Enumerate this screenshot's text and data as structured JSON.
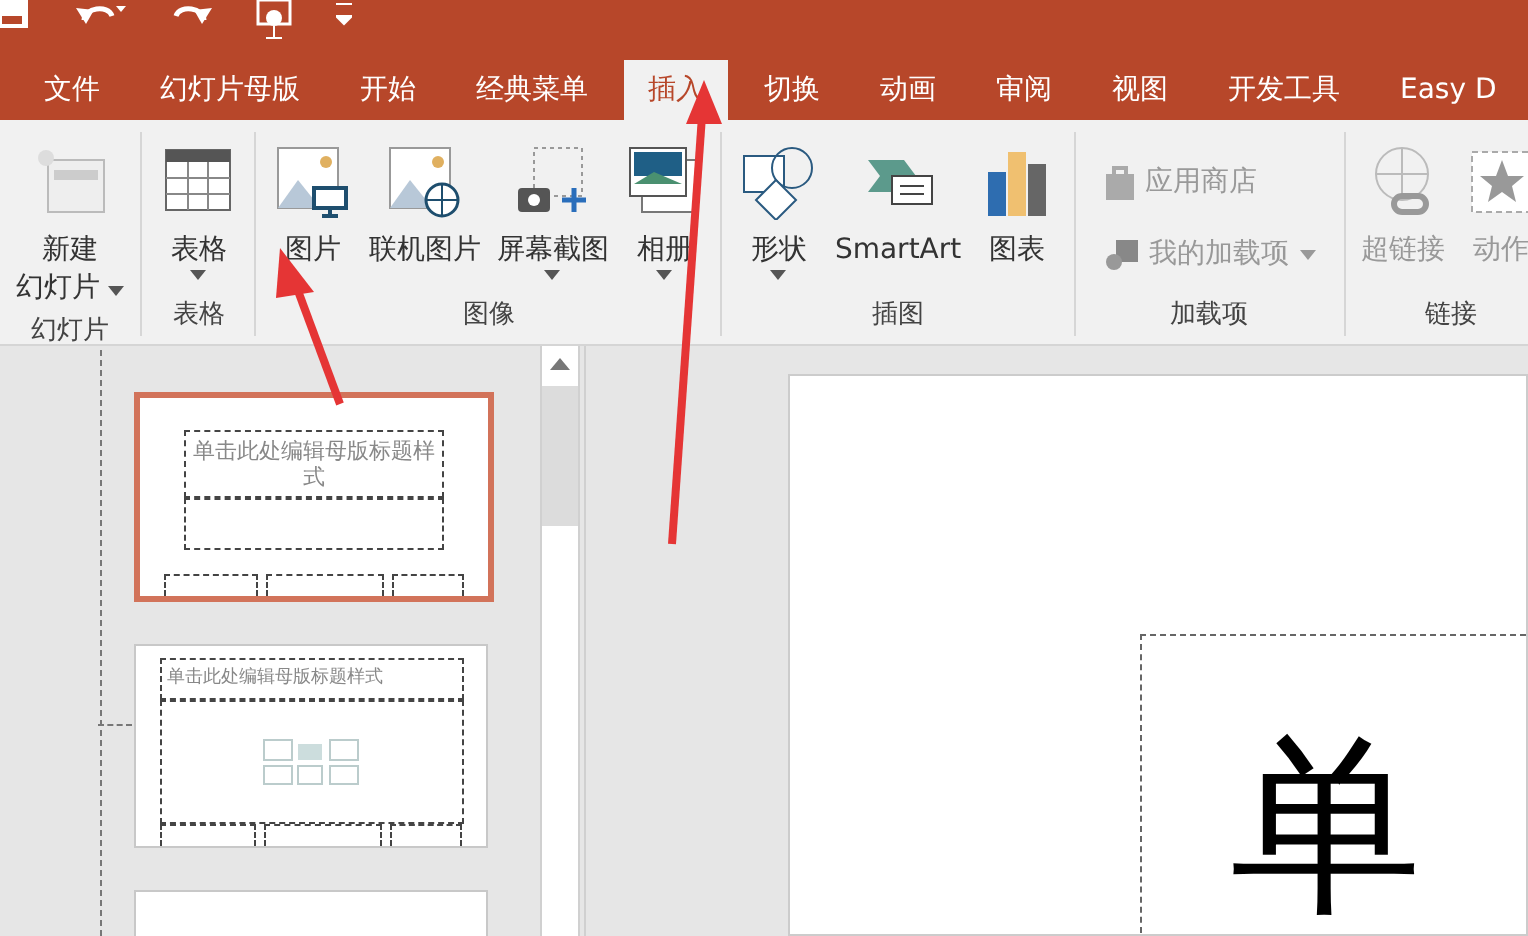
{
  "tabs": [
    {
      "label": "文件",
      "selected": false
    },
    {
      "label": "幻灯片母版",
      "selected": false
    },
    {
      "label": "开始",
      "selected": false
    },
    {
      "label": "经典菜单",
      "selected": false
    },
    {
      "label": "插入",
      "selected": true
    },
    {
      "label": "切换",
      "selected": false
    },
    {
      "label": "动画",
      "selected": false
    },
    {
      "label": "审阅",
      "selected": false
    },
    {
      "label": "视图",
      "selected": false
    },
    {
      "label": "开发工具",
      "selected": false
    },
    {
      "label": "Easy D",
      "selected": false
    }
  ],
  "ribbon_groups": [
    {
      "label": "幻灯片",
      "items": [
        {
          "kind": "large",
          "lines": [
            "新建",
            "幻灯片"
          ],
          "dropdown": true,
          "disabled": false
        }
      ]
    },
    {
      "label": "表格",
      "items": [
        {
          "kind": "large",
          "lines": [
            "表格"
          ],
          "dropdown": true,
          "disabled": false
        }
      ]
    },
    {
      "label": "图像",
      "items": [
        {
          "kind": "large",
          "lines": [
            "图片"
          ],
          "dropdown": false,
          "disabled": false
        },
        {
          "kind": "large",
          "lines": [
            "联机图片"
          ],
          "dropdown": false,
          "disabled": false
        },
        {
          "kind": "large",
          "lines": [
            "屏幕截图"
          ],
          "dropdown": true,
          "disabled": false
        },
        {
          "kind": "large",
          "lines": [
            "相册"
          ],
          "dropdown": true,
          "disabled": false
        }
      ]
    },
    {
      "label": "插图",
      "items": [
        {
          "kind": "large",
          "lines": [
            "形状"
          ],
          "dropdown": true,
          "disabled": false
        },
        {
          "kind": "large",
          "lines": [
            "SmartArt"
          ],
          "dropdown": false,
          "disabled": false
        },
        {
          "kind": "large",
          "lines": [
            "图表"
          ],
          "dropdown": false,
          "disabled": false
        }
      ]
    },
    {
      "label": "加载项",
      "items": [
        {
          "kind": "small",
          "lines": [
            "应用商店"
          ],
          "dropdown": false,
          "disabled": true
        },
        {
          "kind": "small",
          "lines": [
            "我的加载项"
          ],
          "dropdown": true,
          "disabled": true
        }
      ]
    },
    {
      "label": "链接",
      "items": [
        {
          "kind": "large",
          "lines": [
            "超链接"
          ],
          "dropdown": false,
          "disabled": true
        },
        {
          "kind": "large",
          "lines": [
            "动作"
          ],
          "dropdown": false,
          "disabled": true
        }
      ]
    }
  ],
  "thumbnails": [
    {
      "title": "单击此处编辑母版标题样式",
      "kind": "title",
      "selected": true
    },
    {
      "title": "单击此处编辑母版标题样式",
      "kind": "content",
      "selected": false
    },
    {
      "kind": "blank",
      "selected": false
    }
  ],
  "slide": {
    "title": "单"
  }
}
